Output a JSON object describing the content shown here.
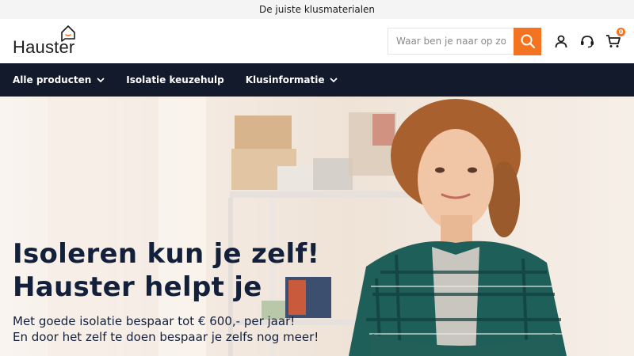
{
  "topbar": {
    "text": "De juiste klusmaterialen"
  },
  "header": {
    "logo_text": "Hauster",
    "search": {
      "placeholder": "Waar ben je naar op zoek?",
      "value": ""
    },
    "cart_count": "0",
    "icons": [
      "search-icon",
      "account-icon",
      "support-icon",
      "cart-icon"
    ]
  },
  "nav": {
    "items": [
      {
        "label": "Alle producten",
        "has_dropdown": true
      },
      {
        "label": "Isolatie keuzehulp",
        "has_dropdown": false
      },
      {
        "label": "Klusinformatie",
        "has_dropdown": true
      }
    ]
  },
  "hero": {
    "title_line1": "Isoleren kun je zelf!",
    "title_line2": "Hauster helpt je",
    "subtitle_line1": "Met goede isolatie bespaar tot € 600,- per jaar!",
    "subtitle_line2": "En door het zelf te doen bespaar je zelfs nog meer!"
  },
  "colors": {
    "accent": "#f37321",
    "nav_bg": "#121a2b",
    "text_dark": "#13203b",
    "topbar_bg": "#f4f4f4"
  }
}
